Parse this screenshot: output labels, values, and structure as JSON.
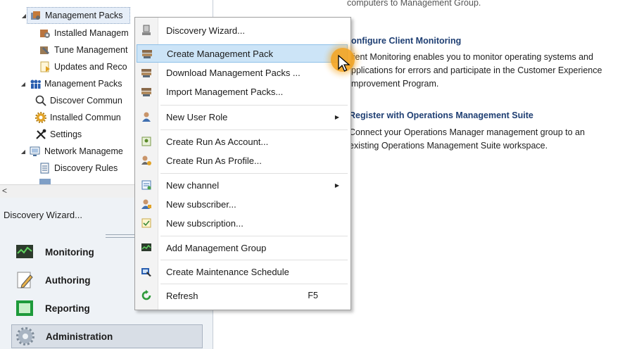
{
  "tree": {
    "items": [
      {
        "label": "Management Packs",
        "icon": "management-pack-icon"
      },
      {
        "label": "Installed Managem",
        "icon": "installed-mp-icon"
      },
      {
        "label": "Tune Management",
        "icon": "tune-mp-icon"
      },
      {
        "label": "Updates and Reco",
        "icon": "updates-icon"
      },
      {
        "label": "Management Packs",
        "icon": "community-packs-icon"
      },
      {
        "label": "Discover Commun",
        "icon": "magnifier-icon"
      },
      {
        "label": "Installed Commun",
        "icon": "gear-icon"
      },
      {
        "label": "Settings",
        "icon": "settings-tools-icon"
      },
      {
        "label": "Network Manageme",
        "icon": "network-icon"
      },
      {
        "label": "Discovery Rules",
        "icon": "discovery-rules-icon"
      }
    ]
  },
  "tasks": {
    "discovery_wizard": "Discovery Wizard..."
  },
  "wunderbar": [
    {
      "label": "Monitoring",
      "icon": "monitoring-icon"
    },
    {
      "label": "Authoring",
      "icon": "authoring-icon"
    },
    {
      "label": "Reporting",
      "icon": "reporting-icon"
    },
    {
      "label": "Administration",
      "icon": "administration-gear-icon"
    }
  ],
  "content": {
    "top_line": "computers to Management Group.",
    "section1": {
      "heading": "onfigure Client Monitoring",
      "lines": [
        "lient Monitoring enables you to monitor operating systems and",
        "pplications for errors and participate in the Customer Experience",
        "mprovement Program."
      ]
    },
    "section2": {
      "heading": "Register with Operations Management Suite",
      "lines": [
        "Connect your Operations Manager management group to an",
        "existing Operations Management Suite workspace."
      ]
    }
  },
  "menu": {
    "items": [
      {
        "label": "Discovery Wizard...",
        "icon": "discovery-wizard-icon"
      },
      {
        "label": "Create Management Pack",
        "icon": "create-mp-icon"
      },
      {
        "label": "Download Management Packs ...",
        "icon": "download-mp-icon"
      },
      {
        "label": "Import Management Packs...",
        "icon": "import-mp-icon"
      },
      {
        "label": "New User Role",
        "icon": "user-role-icon"
      },
      {
        "label": "Create Run As Account...",
        "icon": "run-as-account-icon"
      },
      {
        "label": "Create Run As Profile...",
        "icon": "run-as-profile-icon"
      },
      {
        "label": "New channel",
        "icon": "channel-icon"
      },
      {
        "label": "New subscriber...",
        "icon": "subscriber-icon"
      },
      {
        "label": "New subscription...",
        "icon": "subscription-icon"
      },
      {
        "label": "Add Management Group",
        "icon": "management-group-icon"
      },
      {
        "label": "Create Maintenance Schedule",
        "icon": "maintenance-schedule-icon"
      },
      {
        "label": "Refresh",
        "icon": "refresh-icon",
        "shortcut": "F5"
      }
    ],
    "highlighted": "Create Management Pack"
  },
  "colors": {
    "accent": "#f4a41f",
    "highlight": "#cce4f7",
    "heading": "#1f3f73"
  }
}
